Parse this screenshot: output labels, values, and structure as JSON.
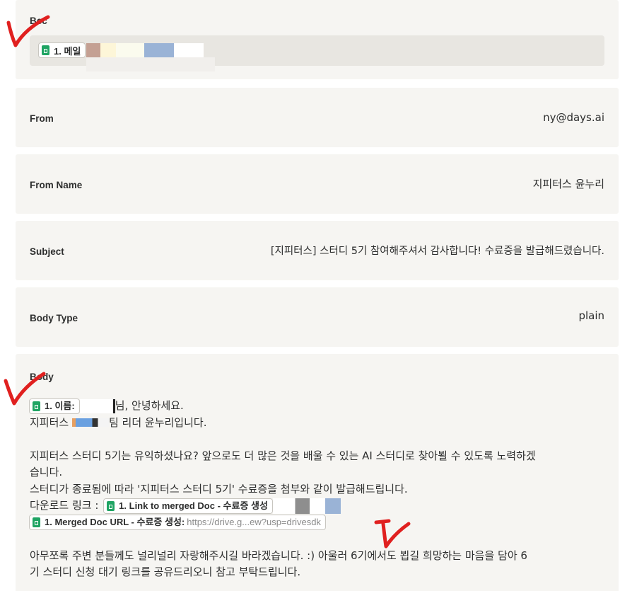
{
  "bcc": {
    "label": "Bcc",
    "pill_text": "1. 메일"
  },
  "from": {
    "label": "From",
    "value": "ny@days.ai"
  },
  "from_name": {
    "label": "From Name",
    "value": "지피터스 윤누리"
  },
  "subject": {
    "label": "Subject",
    "value": "[지피터스] 스터디 5기 참여해주셔서 감사합니다! 수료증을 발급해드렸습니다."
  },
  "body_type": {
    "label": "Body Type",
    "value": "plain"
  },
  "body": {
    "label": "Body",
    "name_pill": "1. 이름:",
    "line1_suffix": "님, 안녕하세요.",
    "line2_prefix": "지피터스 ",
    "line2_suffix": "팀 리더 윤누리입니다.",
    "line3": "지피터스 스터디 5기는 유익하셨나요? 앞으로도 더 많은 것을 배울 수 있는 AI 스터디로 찾아뵐 수 있도록 노력하겠",
    "line4": "습니다.",
    "line5": "스터디가 종료됨에 따라 '지피터스 스터디 5기' 수료증을 첨부와 같이 발급해드립니다.",
    "download_label": "다운로드 링크 :",
    "link_pill": "1. Link to merged Doc - 수료증 생성",
    "url_pill": "1. Merged Doc URL - 수료증 생성:",
    "url_value": "https://drive.g...ew?usp=drivesdk",
    "line8": "아무쪼록 주변 분들께도 널리널리 자랑해주시길 바라겠습니다. :) 아울러 6기에서도 뵙길 희망하는 마음을 담아 6",
    "line9": "기 스터디 신청 대기 링크를 공유드리오니 참고 부탁드립니다."
  },
  "colors": {
    "card_bg": "#f6f5f2",
    "sheet_icon": "#1fa463",
    "annotation_red": "#e0201f"
  }
}
